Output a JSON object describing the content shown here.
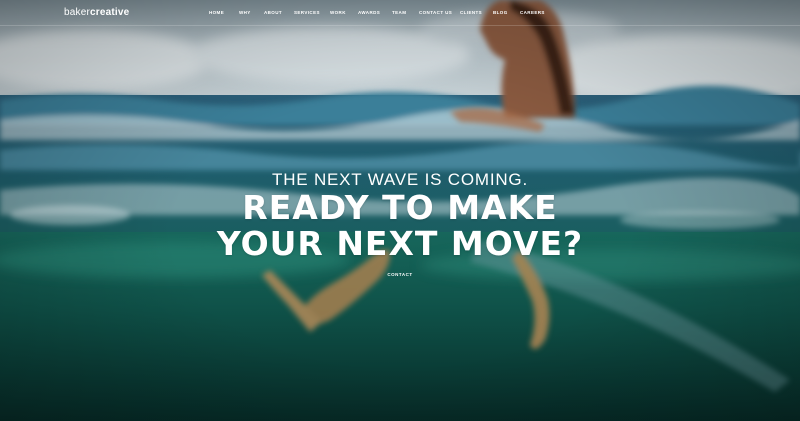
{
  "header": {
    "logo_light": "baker",
    "logo_bold": "creative"
  },
  "nav": {
    "items": [
      {
        "label": "HOME"
      },
      {
        "label": "WHY"
      },
      {
        "label": "ABOUT"
      },
      {
        "label": "SERVICES"
      },
      {
        "label": "WORK"
      },
      {
        "label": "AWARDS"
      },
      {
        "label": "TEAM"
      },
      {
        "label": "CONTACT US"
      },
      {
        "label": "CLIENTS"
      },
      {
        "label": "BLOG"
      },
      {
        "label": "CAREERS"
      }
    ]
  },
  "hero": {
    "kicker": "THE NEXT WAVE IS COMING.",
    "headline_line1": "READY TO MAKE",
    "headline_line2": "YOUR NEXT MOVE?",
    "cta_label": "CONTACT"
  },
  "colors": {
    "text": "#ffffff",
    "sky": "#c9d3d8",
    "wave": "#2e6f8a",
    "underwater": "#0f5a4f"
  }
}
